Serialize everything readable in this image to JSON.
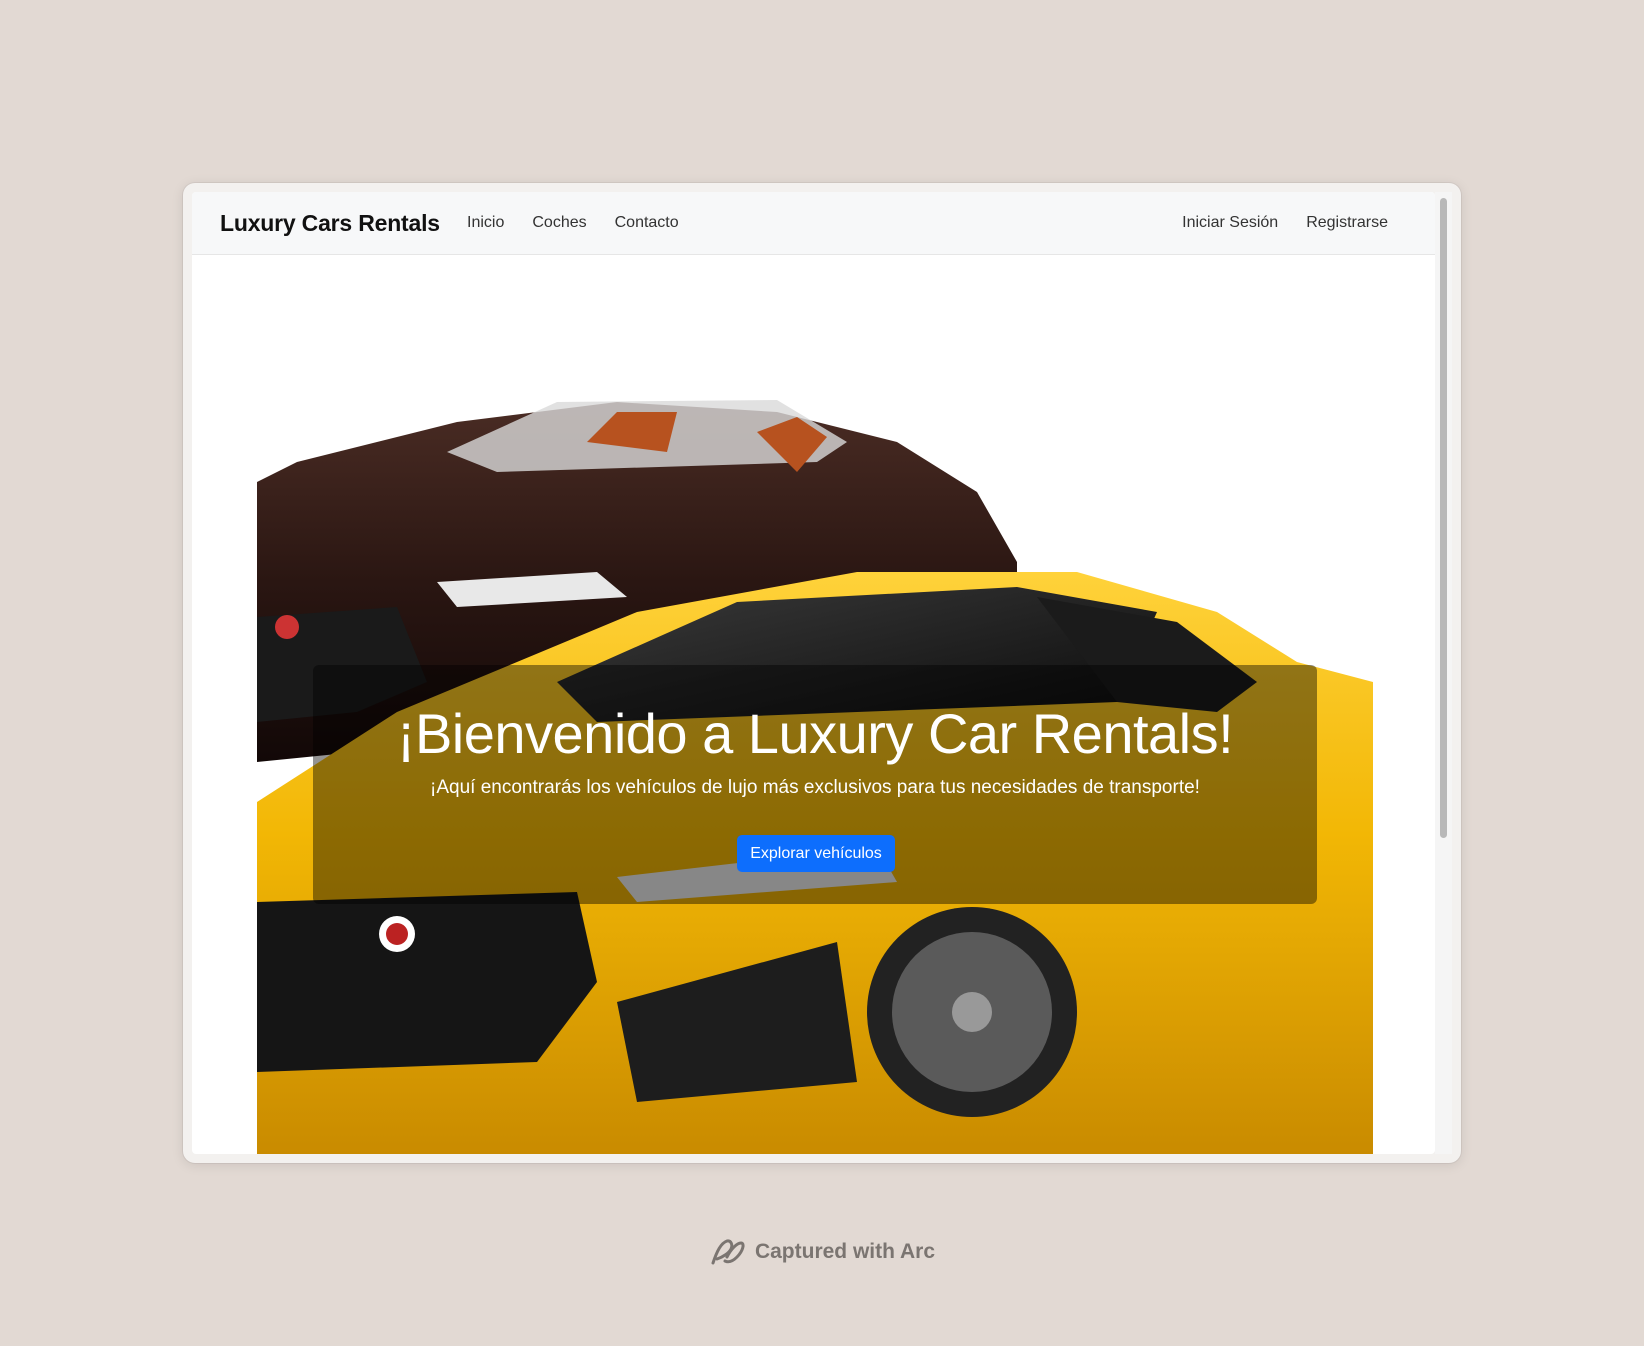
{
  "navbar": {
    "brand": "Luxury Cars Rentals",
    "links": [
      "Inicio",
      "Coches",
      "Contacto"
    ],
    "auth": {
      "login": "Iniciar Sesión",
      "register": "Registrarse"
    }
  },
  "hero": {
    "title": "¡Bienvenido a Luxury Car Rentals!",
    "subtitle": "¡Aquí encontrarás los vehículos de lujo más exclusivos para tus necesidades de transporte!",
    "cta_label": "Explorar vehículos"
  },
  "caption": "Captured with Arc",
  "colors": {
    "primary_button": "#0d6efd",
    "navbar_bg": "#f7f8f9",
    "page_bg": "#e2d9d3",
    "car_yellow": "#f2b705",
    "car_brown": "#2a1612"
  },
  "icons": [
    "arc-logo-icon",
    "jaguar-badge-icon"
  ]
}
